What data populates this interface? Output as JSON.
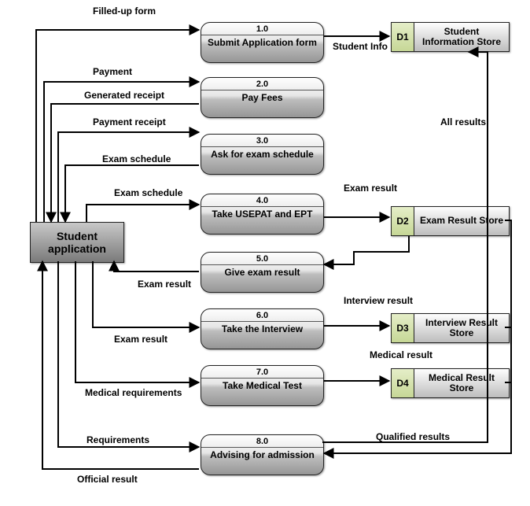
{
  "chart_data": {
    "type": "data-flow-diagram",
    "external_entity": {
      "id": "E1",
      "name": "Student application"
    },
    "processes": [
      {
        "id": "1.0",
        "name": "Submit Application form"
      },
      {
        "id": "2.0",
        "name": "Pay Fees"
      },
      {
        "id": "3.0",
        "name": "Ask for exam schedule"
      },
      {
        "id": "4.0",
        "name": "Take USEPAT and EPT"
      },
      {
        "id": "5.0",
        "name": "Give exam result"
      },
      {
        "id": "6.0",
        "name": "Take the Interview"
      },
      {
        "id": "7.0",
        "name": "Take Medical Test"
      },
      {
        "id": "8.0",
        "name": "Advising for admission"
      }
    ],
    "data_stores": [
      {
        "id": "D1",
        "name": "Student Information Store"
      },
      {
        "id": "D2",
        "name": "Exam Result Store"
      },
      {
        "id": "D3",
        "name": "Interview Result Store"
      },
      {
        "id": "D4",
        "name": "Medical Result Store"
      }
    ],
    "flows": [
      {
        "from": "E1",
        "to": "1.0",
        "label": "Filled-up form"
      },
      {
        "from": "1.0",
        "to": "D1",
        "label": "Student Info"
      },
      {
        "from": "E1",
        "to": "2.0",
        "label": "Payment"
      },
      {
        "from": "2.0",
        "to": "E1",
        "label": "Generated receipt"
      },
      {
        "from": "E1",
        "to": "3.0",
        "label": "Payment receipt"
      },
      {
        "from": "3.0",
        "to": "E1",
        "label": "Exam schedule"
      },
      {
        "from": "E1",
        "to": "4.0",
        "label": "Exam schedule"
      },
      {
        "from": "4.0",
        "to": "D2",
        "label": "Exam result"
      },
      {
        "from": "D2",
        "to": "5.0",
        "label": ""
      },
      {
        "from": "5.0",
        "to": "E1",
        "label": "Exam result"
      },
      {
        "from": "E1",
        "to": "6.0",
        "label": "Exam result"
      },
      {
        "from": "6.0",
        "to": "D3",
        "label": "Interview result"
      },
      {
        "from": "E1",
        "to": "7.0",
        "label": "Medical requirements"
      },
      {
        "from": "7.0",
        "to": "D4",
        "label": "Medical result"
      },
      {
        "from": "D2",
        "to": "8.0",
        "label": "Qualified results"
      },
      {
        "from": "D3",
        "to": "8.0",
        "label": "Qualified results"
      },
      {
        "from": "D4",
        "to": "8.0",
        "label": "Qualified results"
      },
      {
        "from": "E1",
        "to": "8.0",
        "label": "Requirements"
      },
      {
        "from": "8.0",
        "to": "E1",
        "label": "Official result"
      },
      {
        "from": "8.0",
        "to": "D1",
        "label": "All results"
      }
    ]
  },
  "entity": {
    "label": "Student\napplication"
  },
  "processes": [
    {
      "num": "1.0",
      "label": "Submit Application form"
    },
    {
      "num": "2.0",
      "label": "Pay Fees"
    },
    {
      "num": "3.0",
      "label": "Ask for exam schedule"
    },
    {
      "num": "4.0",
      "label": "Take USEPAT and EPT"
    },
    {
      "num": "5.0",
      "label": "Give exam result"
    },
    {
      "num": "6.0",
      "label": "Take the Interview"
    },
    {
      "num": "7.0",
      "label": "Take Medical Test"
    },
    {
      "num": "8.0",
      "label": "Advising for admission"
    }
  ],
  "stores": [
    {
      "id": "D1",
      "label": "Student Information Store"
    },
    {
      "id": "D2",
      "label": "Exam Result Store"
    },
    {
      "id": "D3",
      "label": "Interview Result Store"
    },
    {
      "id": "D4",
      "label": "Medical Result Store"
    }
  ],
  "flow_labels": {
    "filled_up_form": "Filled-up form",
    "student_info": "Student Info",
    "payment": "Payment",
    "generated_receipt": "Generated receipt",
    "payment_receipt": "Payment receipt",
    "exam_schedule_out": "Exam schedule",
    "exam_schedule_in": "Exam schedule",
    "exam_result_to_store": "Exam result",
    "exam_result_back": "Exam result",
    "exam_result_to_interview": "Exam result",
    "interview_result": "Interview result",
    "medical_requirements": "Medical requirements",
    "medical_result": "Medical result",
    "requirements": "Requirements",
    "official_result": "Official result",
    "qualified_results": "Qualified results",
    "all_results": "All results"
  }
}
